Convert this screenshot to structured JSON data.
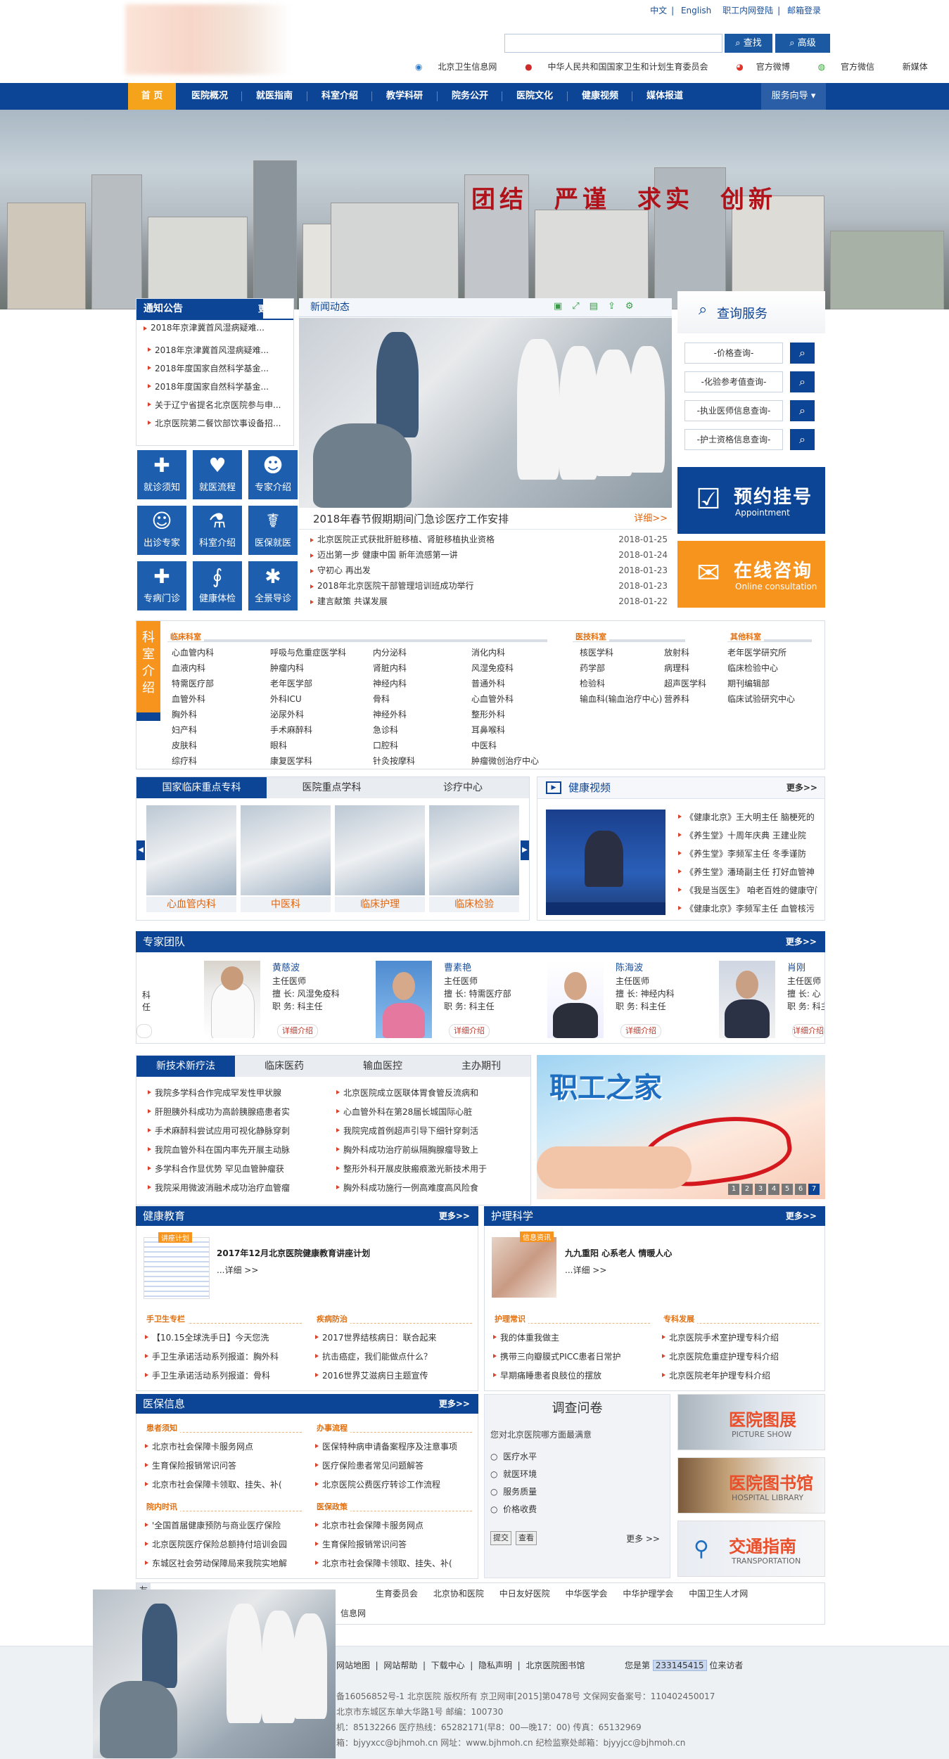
{
  "header": {
    "top_links": [
      "中文",
      "English",
      "职工内网登陆",
      "邮箱登录"
    ],
    "search_button": "查找",
    "advanced_button": "高级",
    "sub_links": [
      "北京卫生信息网",
      "中华人民共和国国家卫生和计划生育委员会",
      "官方微博",
      "官方微信",
      "新媒体"
    ]
  },
  "nav": {
    "items": [
      "首 页",
      "医院概况",
      "就医指南",
      "科室介绍",
      "教学科研",
      "院务公开",
      "医院文化",
      "健康视频",
      "媒体报道"
    ],
    "service": "服务向导"
  },
  "banner": {
    "slogan": [
      "团结",
      "严谨",
      "求实",
      "创新"
    ]
  },
  "notice": {
    "title": "通知公告",
    "more": "更多>>",
    "items": [
      "2018年京津冀首风湿病疑难...",
      "2018年京津冀首风湿病疑难...",
      "2018年度国家自然科学基金...",
      "2018年度国家自然科学基金...",
      "关于辽宁省提名北京医院参与申...",
      "北京医院第二餐饮部饮事设备招..."
    ]
  },
  "quick_icons": [
    {
      "label": "就诊须知",
      "icon": "medkit-icon",
      "glyph": "✚"
    },
    {
      "label": "就医流程",
      "icon": "heart-icon",
      "glyph": "♥"
    },
    {
      "label": "专家介绍",
      "icon": "doctor-icon",
      "glyph": "☻"
    },
    {
      "label": "出诊专家",
      "icon": "doctor-board-icon",
      "glyph": "☺"
    },
    {
      "label": "科室介绍",
      "icon": "microscope-icon",
      "glyph": "⚗"
    },
    {
      "label": "医保就医",
      "icon": "nurse-icon",
      "glyph": "☤"
    },
    {
      "label": "专病门诊",
      "icon": "ambulance-icon",
      "glyph": "✚"
    },
    {
      "label": "健康体检",
      "icon": "stethoscope-icon",
      "glyph": "∮"
    },
    {
      "label": "全景导诊",
      "icon": "star-of-life-icon",
      "glyph": "✱"
    }
  ],
  "news": {
    "title": "新闻动态",
    "headline": "2018年春节假期期间门急诊医疗工作安排",
    "detail": "详细>>",
    "items": [
      {
        "text": "北京医院正式获批肝脏移植、肾脏移植执业资格",
        "date": "2018-01-25"
      },
      {
        "text": "迈出第一步 健康中国 新年流感第一讲",
        "date": "2018-01-24"
      },
      {
        "text": "守初心 再出发",
        "date": "2018-01-23"
      },
      {
        "text": "2018年北京医院干部管理培训班成功举行",
        "date": "2018-01-23"
      },
      {
        "text": "建言献策 共谋发展",
        "date": "2018-01-22"
      }
    ]
  },
  "query": {
    "title": "查询服务",
    "items": [
      "-价格查询-",
      "-化验参考值查询-",
      "-执业医师信息查询-",
      "-护士资格信息查询-"
    ]
  },
  "appointment": {
    "title": "预约挂号",
    "subtitle": "Appointment"
  },
  "consult": {
    "title": "在线咨询",
    "subtitle": "Online consultation"
  },
  "departments": {
    "side_title": "科室介绍",
    "headers": [
      "临床科室",
      "医技科室",
      "其他科室"
    ],
    "clinical": [
      [
        "心血管内科",
        "呼吸与危重症医学科",
        "内分泌科",
        "消化内科"
      ],
      [
        "血液内科",
        "肿瘤内科",
        "肾脏内科",
        "风湿免疫科"
      ],
      [
        "特需医疗部",
        "老年医学部",
        "神经内科",
        "普通外科"
      ],
      [
        "血管外科",
        "外科ICU",
        "骨科",
        "心血管外科"
      ],
      [
        "胸外科",
        "泌尿外科",
        "神经外科",
        "整形外科"
      ],
      [
        "妇产科",
        "手术麻醉科",
        "急诊科",
        "耳鼻喉科"
      ],
      [
        "皮肤科",
        "眼科",
        "口腔科",
        "中医科"
      ],
      [
        "综疗科",
        "康复医学科",
        "针灸按摩科",
        "肿瘤微创治疗中心"
      ]
    ],
    "technical": [
      [
        "核医学科",
        "放射科"
      ],
      [
        "药学部",
        "病理科"
      ],
      [
        "检验科",
        "超声医学科"
      ],
      [
        "输血科(输血治疗中心)",
        "营养科"
      ]
    ],
    "other": [
      "老年医学研究所",
      "临床检验中心",
      "期刊编辑部",
      "临床试验研究中心"
    ]
  },
  "specialty": {
    "tabs": [
      "国家临床重点专科",
      "医院重点学科",
      "诊疗中心"
    ],
    "items": [
      "心血管内科",
      "中医科",
      "临床护理",
      "临床检验"
    ]
  },
  "video": {
    "title": "健康视频",
    "more": "更多>>",
    "items": [
      "《健康北京》王大明主任 脑梗死的",
      "《养生堂》十周年庆典 王建业院",
      "《养生堂》李频军主任 冬季谨防",
      "《养生堂》潘琦副主任 打好血管神",
      "《我是当医生》 咱老百姓的健康守门",
      "《健康北京》李频军主任 血管核污"
    ]
  },
  "experts": {
    "title": "专家团队",
    "more": "更多>>",
    "list": [
      {
        "name": "黄慈波",
        "title": "主任医师",
        "good_at": "擅 长: 风湿免疫科",
        "position": "职 务: 科主任"
      },
      {
        "name": "曹素艳",
        "title": "主任医师",
        "good_at": "擅 长: 特需医疗部",
        "position": "职 务: 科主任"
      },
      {
        "name": "陈海波",
        "title": "主任医师",
        "good_at": "擅 长: 神经内科",
        "position": "职 务: 科主任"
      },
      {
        "name": "肖刚",
        "title": "主任医师",
        "good_at": "擅 长: 心",
        "position": "职 务: 科主"
      }
    ],
    "detail_button": "详细介绍"
  },
  "newtech": {
    "tabs": [
      "新技术新疗法",
      "临床医药",
      "输血医控",
      "主办期刊"
    ],
    "col1": [
      "我院多学科合作完成罕发性甲状腺",
      "肝胆胰外科成功为高龄胰腺癌患者实",
      "手术麻醉科尝试应用可视化静脉穿刺",
      "我院血管外科在国内率先开展主动脉",
      "多学科合作显优势 罕见血管肿瘤获",
      "我院采用微波消融术成功治疗血管瘤"
    ],
    "col2": [
      "北京医院成立医联体胃食管反流病和",
      "心血管外科在第28届长城国际心脏",
      "我院完成首例超声引导下细针穿刺活",
      "胸外科成功治疗前纵隔胸腺瘤导致上",
      "整形外科开展皮肤瘢痕激光新技术用于",
      "胸外科成功施行一例高难度高风险食"
    ]
  },
  "staff_home": {
    "title": "职工之家",
    "pages": [
      "1",
      "2",
      "3",
      "4",
      "5",
      "6",
      "7"
    ]
  },
  "health_edu": {
    "title": "健康教育",
    "more": "更多>>",
    "tag": "讲座计划",
    "feature": "2017年12月北京医院健康教育讲座计划",
    "detail": "...详细 >>",
    "sub1": "手卫生专栏",
    "sub2": "疾病防治",
    "col1": [
      "【10.15全球洗手日】今天您洗",
      "手卫生承诺活动系列报道：胸外科",
      "手卫生承诺活动系列报道：骨科"
    ],
    "col2": [
      "2017世界结核病日：联合起来",
      "抗击癌症，我们能做点什么？",
      "2016世界艾滋病日主题宣传"
    ]
  },
  "nursing": {
    "title": "护理科学",
    "more": "更多>>",
    "tag": "信息资讯",
    "feature": "九九重阳 心系老人 情暖人心",
    "detail": "...详细 >>",
    "sub1": "护理常识",
    "sub2": "专科发展",
    "col1": [
      "我的体重我做主",
      "携带三向瓣膜式PICC患者日常护",
      "早期痛睡患者良肢位的摆放"
    ],
    "col2": [
      "北京医院手术室护理专科介绍",
      "北京医院危重症护理专科介绍",
      "北京医院老年护理专科介绍"
    ]
  },
  "insurance": {
    "title": "医保信息",
    "more": "更多>>",
    "sub": [
      "患者须知",
      "办事流程",
      "院内时讯",
      "医保政策"
    ],
    "c1": [
      "北京市社会保障卡服务网点",
      "生育保险报销常识问答",
      "北京市社会保障卡领取、挂失、补("
    ],
    "c2": [
      "医保特种病申请备案程序及注意事项",
      "医疗保险患者常见问题解答",
      "北京医院公费医疗转诊工作流程"
    ],
    "c3": [
      "'全国首届健康预防与商业医疗保险",
      "北京医院医疗保险总额持付培训会园",
      "东城区社会劳动保障局来我院实地解"
    ],
    "c4": [
      "北京市社会保障卡服务网点",
      "生育保险报销常识问答",
      "北京市社会保障卡领取、挂失、补("
    ]
  },
  "survey": {
    "title": "调查问卷",
    "question": "您对北京医院哪方面最满意",
    "options": [
      "医疗水平",
      "就医环境",
      "服务质量",
      "价格收费"
    ],
    "submit": "提交",
    "view": "查看",
    "more": "更多 >>"
  },
  "side_banners": [
    {
      "title": "医院图展",
      "subtitle": "PICTURE SHOW"
    },
    {
      "title": "医院图书馆",
      "subtitle": "HOSPITAL LIBRARY"
    },
    {
      "title": "交通指南",
      "subtitle": "TRANSPORTATION"
    }
  ],
  "links": {
    "label": "友",
    "items": [
      "生育委员会",
      "北京协和医院",
      "中日友好医院",
      "中华医学会",
      "中华护理学会",
      "中国卫生人才网"
    ],
    "tail": "信息网"
  },
  "footer": {
    "links": [
      "网站地图",
      "网站帮助",
      "下载中心",
      "隐私声明",
      "北京医院图书馆"
    ],
    "visitor_prefix": "您是第",
    "visitor_count": "233145415",
    "visitor_suffix": "位来访者",
    "line1": "备16056852号-1 北京医院 版权所有 京卫网审[2015]第0478号 文保网安备案号：110402450017",
    "line2": "北京市东城区东单大华路1号 邮编：100730",
    "line3": "机：85132266 医疗热线：65282171(早8：00—晚17：00) 传真：65132969",
    "line4": "箱：bjyyxcc@bjhmoh.cn 网址：www.bjhmoh.cn 纪检监察处邮箱：bjyyjcc@bjhmoh.cn"
  }
}
